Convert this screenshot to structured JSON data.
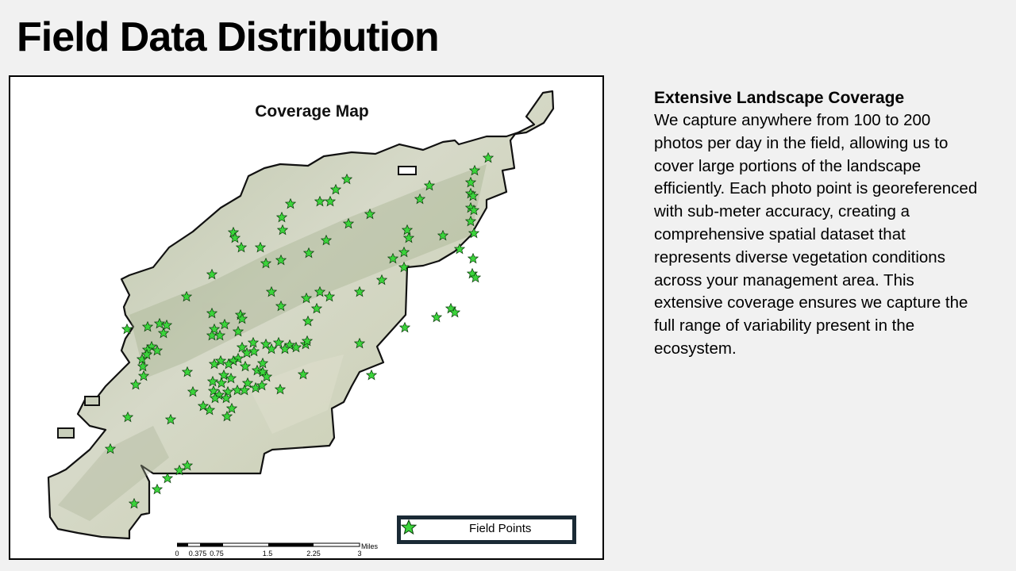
{
  "slide": {
    "title": "Field Data Distribution"
  },
  "map": {
    "title": "Coverage Map",
    "legend": {
      "label": "Field Points",
      "marker": "star-icon",
      "marker_color": "#3bd43b"
    },
    "scale_bar": {
      "ticks": [
        "0",
        "0.375",
        "0.75",
        "1.5",
        "2.25",
        "3"
      ],
      "unit": "Miles"
    },
    "colors": {
      "terrain": "#c9cfbb",
      "boundary": "#111111",
      "point_fill": "#3bd43b"
    }
  },
  "panel": {
    "heading": "Extensive Landscape Coverage",
    "body": "We capture anywhere from 100 to 200 photos per day in the field, allowing us to cover large portions of the landscape efficiently. Each photo point is georeferenced with sub-meter accuracy, creating a comprehensive spatial dataset that represents diverse vegetation conditions across your management area. This extensive coverage ensures we capture the full range of variability present in the ecosystem."
  }
}
